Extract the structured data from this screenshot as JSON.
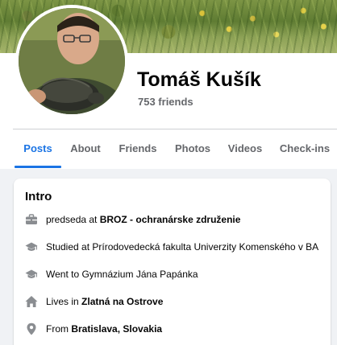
{
  "profile": {
    "name": "Tomáš Kušík",
    "friends": "753 friends"
  },
  "tabs": [
    {
      "label": "Posts",
      "active": true
    },
    {
      "label": "About",
      "active": false
    },
    {
      "label": "Friends",
      "active": false
    },
    {
      "label": "Photos",
      "active": false
    },
    {
      "label": "Videos",
      "active": false
    },
    {
      "label": "Check-ins",
      "active": false
    }
  ],
  "intro": {
    "title": "Intro",
    "items": [
      {
        "icon": "briefcase-icon",
        "prefix": "predseda at ",
        "strong": "BROZ - ochranárske združenie"
      },
      {
        "icon": "graduation-cap-icon",
        "prefix": "Studied at Prírodovedecká fakulta Univerzity Komenského v BA",
        "strong": ""
      },
      {
        "icon": "graduation-cap-icon",
        "prefix": "Went to Gymnázium Jána Papánka",
        "strong": ""
      },
      {
        "icon": "home-icon",
        "prefix": "Lives in ",
        "strong": "Zlatná na Ostrove"
      },
      {
        "icon": "location-pin-icon",
        "prefix": "From ",
        "strong": "Bratislava, Slovakia"
      }
    ]
  },
  "colors": {
    "accent": "#1b74e4",
    "secondary_text": "#65676b",
    "icon": "#8a8d91",
    "background": "#f0f2f5"
  }
}
